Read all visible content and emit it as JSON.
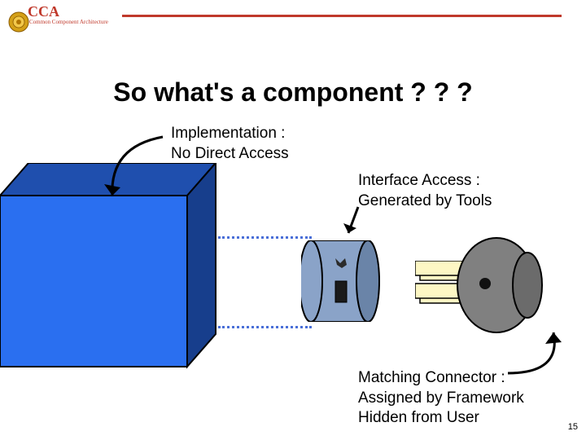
{
  "header": {
    "acronym": "CCA",
    "subtitle": "Common Component Architecture"
  },
  "title": "So what's a component ? ? ?",
  "labels": {
    "implementation": "Implementation :\nNo Direct Access",
    "interface": "Interface Access :\nGenerated by Tools",
    "connector": "Matching Connector :\nAssigned by Framework\nHidden from User"
  },
  "page_number": "15",
  "colors": {
    "accent": "#c0392b",
    "cube_front": "#2a6ff0",
    "cube_top": "#1f4fae",
    "cube_side": "#173e8c",
    "cyl_front": "#8aa3c8",
    "cyl_side": "#6a84a8",
    "connector_gray": "#808080",
    "paper": "#fdf7c4",
    "dots": "#4a6fd8"
  }
}
